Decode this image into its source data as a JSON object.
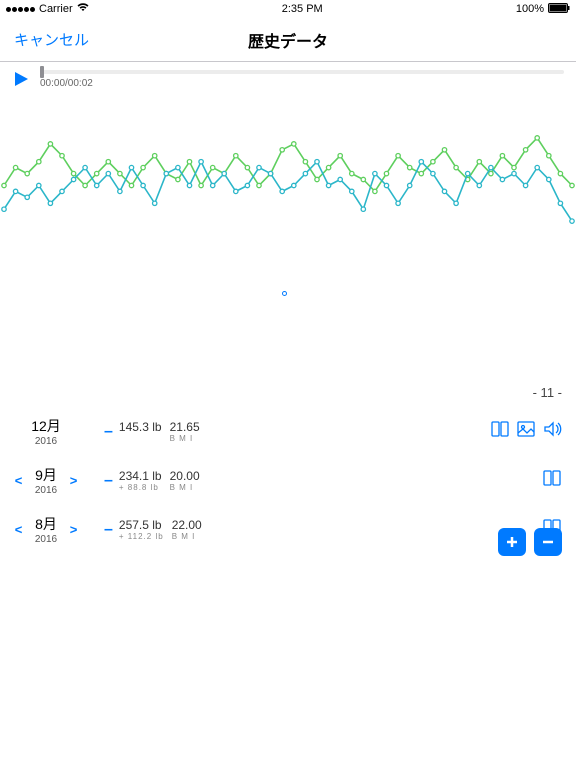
{
  "status": {
    "carrier": "Carrier",
    "time": "2:35 PM",
    "battery": "100%"
  },
  "nav": {
    "cancel": "キャンセル",
    "title": "歴史データ"
  },
  "playback": {
    "time": "00:00/00:02"
  },
  "page_indicator": "- 11 -",
  "rows": [
    {
      "month": "12月",
      "year": "2016",
      "weight": "145.3 lb",
      "weight_delta": "",
      "bmi": "21.65",
      "bmi_label": "B M I",
      "prev": false,
      "next": false,
      "icons": [
        "book",
        "image",
        "sound"
      ]
    },
    {
      "month": "9月",
      "year": "2016",
      "weight": "234.1 lb",
      "weight_delta": "+ 88.8 lb",
      "bmi": "20.00",
      "bmi_label": "B M I",
      "prev": true,
      "next": true,
      "icons": [
        "book"
      ]
    },
    {
      "month": "8月",
      "year": "2016",
      "weight": "257.5 lb",
      "weight_delta": "+ 112.2 lb",
      "bmi": "22.00",
      "bmi_label": "B M I",
      "prev": true,
      "next": true,
      "icons": [
        "book"
      ]
    }
  ],
  "chart_data": {
    "type": "line",
    "x": [
      0,
      1,
      2,
      3,
      4,
      5,
      6,
      7,
      8,
      9,
      10,
      11,
      12,
      13,
      14,
      15,
      16,
      17,
      18,
      19,
      20,
      21,
      22,
      23,
      24,
      25,
      26,
      27,
      28,
      29,
      30,
      31,
      32,
      33,
      34,
      35,
      36,
      37,
      38,
      39,
      40,
      41,
      42,
      43,
      44,
      45,
      46,
      47,
      48,
      49
    ],
    "series": [
      {
        "name": "green",
        "color": "#5ecf5e",
        "values": [
          36,
          42,
          40,
          44,
          50,
          46,
          40,
          36,
          40,
          44,
          40,
          36,
          42,
          46,
          40,
          38,
          44,
          36,
          42,
          40,
          46,
          42,
          36,
          40,
          48,
          50,
          44,
          38,
          42,
          46,
          40,
          38,
          34,
          40,
          46,
          42,
          40,
          44,
          48,
          42,
          38,
          44,
          40,
          46,
          42,
          48,
          52,
          46,
          40,
          36
        ]
      },
      {
        "name": "teal",
        "color": "#2bb6c9",
        "values": [
          28,
          34,
          32,
          36,
          30,
          34,
          38,
          42,
          36,
          40,
          34,
          42,
          36,
          30,
          40,
          42,
          36,
          44,
          36,
          40,
          34,
          36,
          42,
          40,
          34,
          36,
          40,
          44,
          36,
          38,
          34,
          28,
          40,
          36,
          30,
          36,
          44,
          40,
          34,
          30,
          40,
          36,
          42,
          38,
          40,
          36,
          42,
          38,
          30,
          24
        ]
      }
    ],
    "xlabel": "",
    "ylabel": "",
    "ylim": [
      20,
      55
    ]
  }
}
